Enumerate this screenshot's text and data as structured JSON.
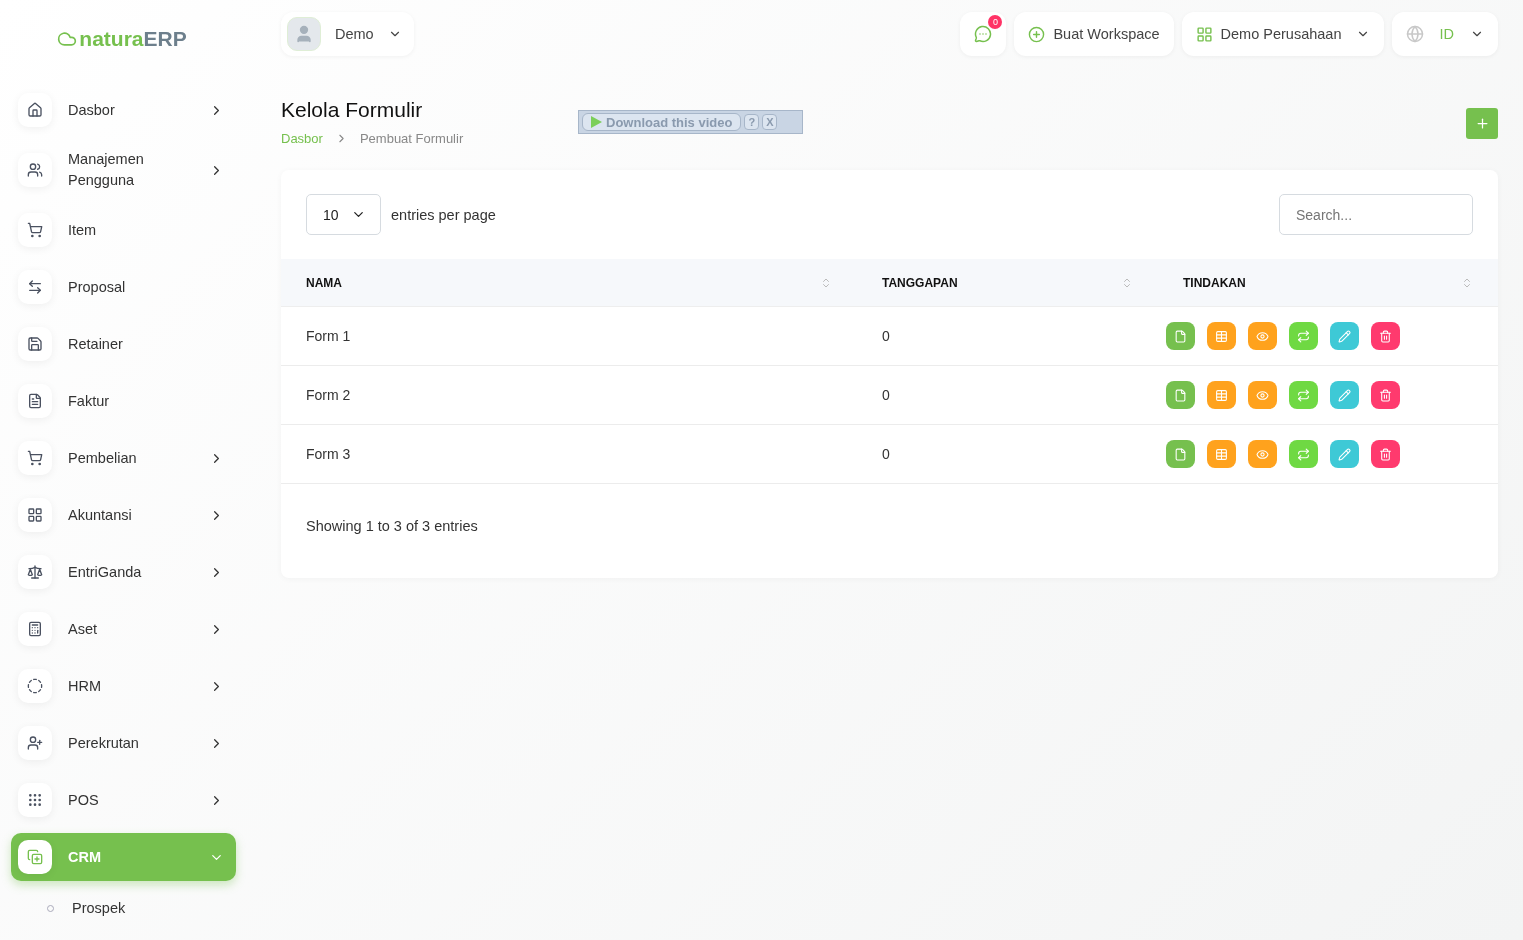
{
  "logo": {
    "brand": "natura",
    "suffix": "ERP"
  },
  "user_menu": {
    "label": "Demo"
  },
  "topbar": {
    "notifications": {
      "count": "0"
    },
    "create_workspace": "Buat Workspace",
    "company": "Demo Perusahaan",
    "language": "ID"
  },
  "sidebar": {
    "items": [
      {
        "label": "Dasbor",
        "expandable": true,
        "selected": false
      },
      {
        "label": "Manajemen Pengguna",
        "expandable": true,
        "selected": false
      },
      {
        "label": "Item",
        "expandable": false,
        "selected": false
      },
      {
        "label": "Proposal",
        "expandable": false,
        "selected": false
      },
      {
        "label": "Retainer",
        "expandable": false,
        "selected": false
      },
      {
        "label": "Faktur",
        "expandable": false,
        "selected": false
      },
      {
        "label": "Pembelian",
        "expandable": true,
        "selected": false
      },
      {
        "label": "Akuntansi",
        "expandable": true,
        "selected": false
      },
      {
        "label": "EntriGanda",
        "expandable": true,
        "selected": false
      },
      {
        "label": "Aset",
        "expandable": true,
        "selected": false
      },
      {
        "label": "HRM",
        "expandable": true,
        "selected": false
      },
      {
        "label": "Perekrutan",
        "expandable": true,
        "selected": false
      },
      {
        "label": "POS",
        "expandable": true,
        "selected": false
      },
      {
        "label": "CRM",
        "expandable": true,
        "selected": true,
        "children": [
          {
            "label": "Prospek"
          }
        ]
      }
    ]
  },
  "page": {
    "title": "Kelola Formulir",
    "breadcrumb": [
      "Dasbor",
      "Pembuat Formulir"
    ]
  },
  "overlay": {
    "label": "Download this video",
    "help": "?",
    "close": "X"
  },
  "table": {
    "page_size": "10",
    "page_size_label": "entries per page",
    "search": {
      "placeholder": "Search..."
    },
    "columns": [
      "NAMA",
      "TANGGAPAN",
      "TINDAKAN"
    ],
    "rows": [
      {
        "name": "Form 1",
        "responses": "0"
      },
      {
        "name": "Form 2",
        "responses": "0"
      },
      {
        "name": "Form 3",
        "responses": "0"
      }
    ],
    "footer": "Showing 1 to 3 of 3 entries"
  }
}
